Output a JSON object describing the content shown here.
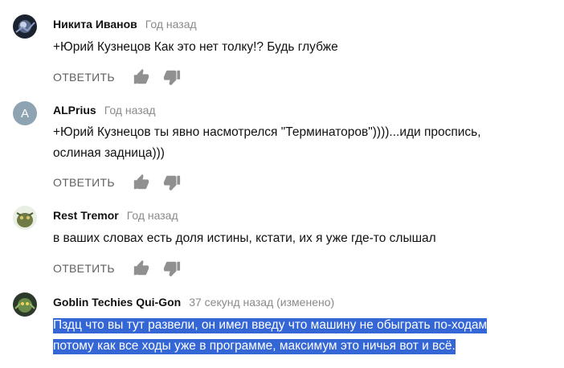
{
  "comments": [
    {
      "author": "Никита Иванов",
      "time": "Год назад",
      "text_lines": [
        "+Юрий Кузнецов Как это нет толку!? Будь глубже"
      ],
      "reply_label": "ОТВЕТИТЬ",
      "avatar_icon": "space-image-avatar-icon"
    },
    {
      "author": "ALPrius",
      "time": "Год назад",
      "avatar_letter": "A",
      "text_lines": [
        "+Юрий Кузнецов ты явно насмотрелся \"Терминаторов\"))))...иди проспись,",
        "ослиная задница)))"
      ],
      "reply_label": "ОТВЕТИТЬ"
    },
    {
      "author": "Rest Tremor",
      "time": "Год назад",
      "text_lines": [
        "в ваших словах есть доля истины, кстати, их я уже где-то слышал"
      ],
      "reply_label": "ОТВЕТИТЬ",
      "avatar_icon": "creature-avatar-icon"
    },
    {
      "author": "Goblin Techies Qui-Gon",
      "time": "37 секунд назад (изменено)",
      "text_lines": [
        "Пздц что вы тут развели, он имел введу что машину не обыграть по-ходам",
        "потому как все ходы уже в программе, максимум это ничья вот и всё."
      ],
      "avatar_icon": "goblin-avatar-icon",
      "highlight_color": "#3466d6"
    }
  ],
  "colors": {
    "author": "#111111",
    "time": "#8a8a8a",
    "reply": "#606060",
    "icon": "#909090"
  }
}
